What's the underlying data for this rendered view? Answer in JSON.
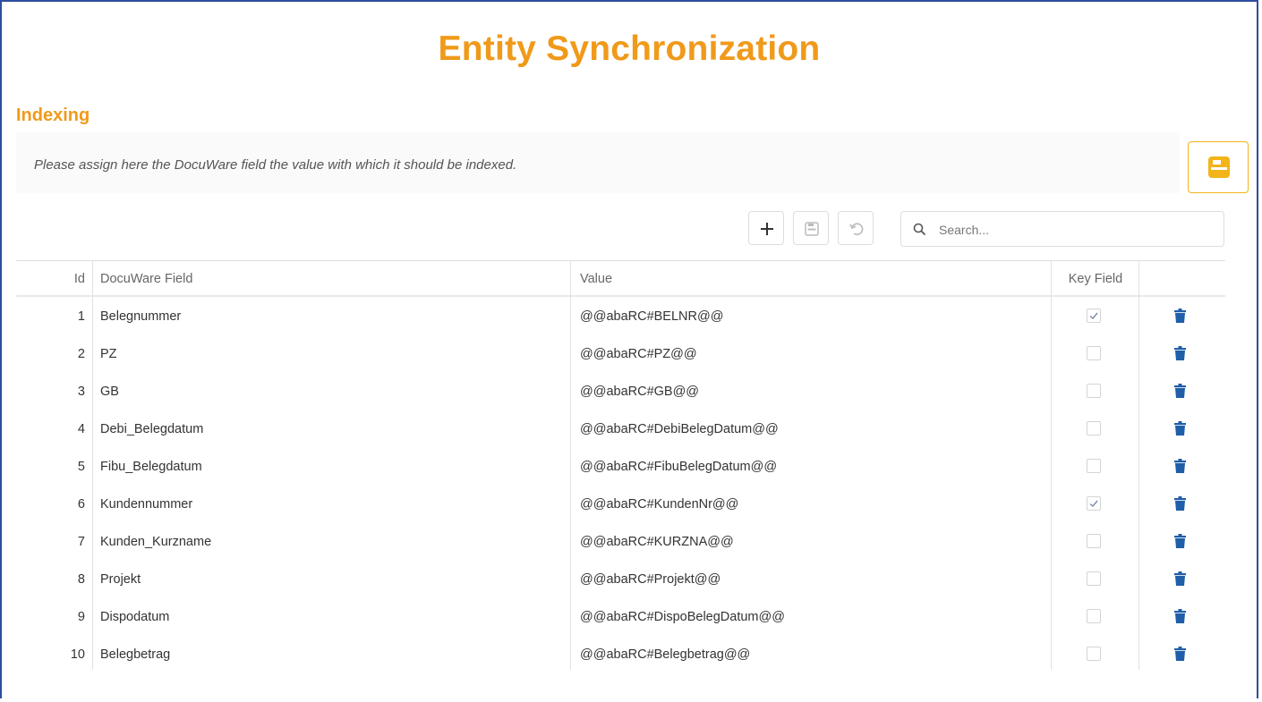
{
  "page": {
    "title": "Entity Synchronization",
    "section_title": "Indexing",
    "info_text": "Please assign here the DocuWare field the value with which it should be indexed."
  },
  "toolbar": {
    "add_icon": "plus-icon",
    "save_icon": "floppy-disk-icon",
    "undo_icon": "undo-icon",
    "search_placeholder": "Search...",
    "search_value": ""
  },
  "colors": {
    "accent_orange": "#f09a1a",
    "save_yellow": "#f2b418",
    "frame_blue": "#2e4d9e",
    "trash_blue": "#1f5ea8"
  },
  "table": {
    "columns": [
      "Id",
      "DocuWare Field",
      "Value",
      "Key Field"
    ],
    "rows": [
      {
        "id": "1",
        "field": "Belegnummer",
        "value": "@@abaRC#BELNR@@",
        "key": true
      },
      {
        "id": "2",
        "field": "PZ",
        "value": "@@abaRC#PZ@@",
        "key": false
      },
      {
        "id": "3",
        "field": "GB",
        "value": "@@abaRC#GB@@",
        "key": false
      },
      {
        "id": "4",
        "field": "Debi_Belegdatum",
        "value": "@@abaRC#DebiBelegDatum@@",
        "key": false
      },
      {
        "id": "5",
        "field": "Fibu_Belegdatum",
        "value": "@@abaRC#FibuBelegDatum@@",
        "key": false
      },
      {
        "id": "6",
        "field": "Kundennummer",
        "value": "@@abaRC#KundenNr@@",
        "key": true
      },
      {
        "id": "7",
        "field": "Kunden_Kurzname",
        "value": "@@abaRC#KURZNA@@",
        "key": false
      },
      {
        "id": "8",
        "field": "Projekt",
        "value": "@@abaRC#Projekt@@",
        "key": false
      },
      {
        "id": "9",
        "field": "Dispodatum",
        "value": "@@abaRC#DispoBelegDatum@@",
        "key": false
      },
      {
        "id": "10",
        "field": "Belegbetrag",
        "value": "@@abaRC#Belegbetrag@@",
        "key": false
      }
    ]
  }
}
